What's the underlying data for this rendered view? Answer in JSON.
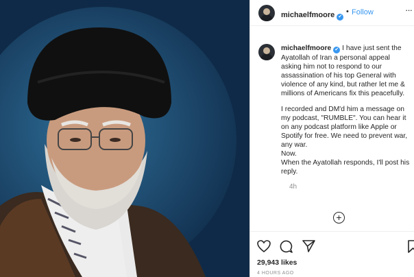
{
  "post": {
    "username": "michaelfmoore",
    "follow_label": "Follow",
    "separator": "•",
    "more_glyph": "···",
    "caption_intro": "I have just sent the Ayatollah of Iran a personal appeal asking him not to respond to our assassination of his top General with violence of any kind, but rather let me & millions of Americans fix this peacefully.",
    "caption_body": "I recorded and DM'd him a message on my podcast, \"RUMBLE\". You can hear it on any podcast platform like Apple or Spotify for free. We need to prevent war, any war.\nNow.\nWhen the Ayatollah responds, I'll post his reply.",
    "time_relative": "4h",
    "likes": "29,943 likes",
    "time_ago": "4 HOURS AGO",
    "verified_glyph": "✔",
    "load_more_glyph": "+"
  },
  "icons": {
    "heart": "heart-icon",
    "comment": "comment-icon",
    "share": "share-icon",
    "save": "bookmark-icon"
  },
  "colors": {
    "link": "#3897f0",
    "image_background": "#0f2a48"
  }
}
